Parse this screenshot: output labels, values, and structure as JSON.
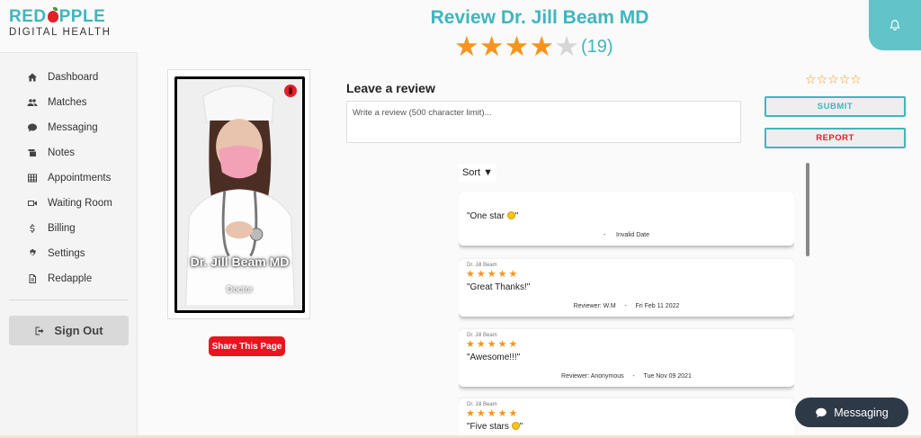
{
  "logo": {
    "line1_a": "RED",
    "line1_b": "PPLE",
    "line2": "DIGITAL HEALTH"
  },
  "header": {
    "title": "Review Dr. Jill Beam MD",
    "rating": 4,
    "max_rating": 5,
    "review_count": "(19)"
  },
  "sidebar": {
    "items": [
      {
        "label": "Dashboard",
        "icon": "home-icon"
      },
      {
        "label": "Matches",
        "icon": "users-icon"
      },
      {
        "label": "Messaging",
        "icon": "chat-icon"
      },
      {
        "label": "Notes",
        "icon": "notes-icon"
      },
      {
        "label": "Appointments",
        "icon": "calendar-grid-icon"
      },
      {
        "label": "Waiting Room",
        "icon": "video-icon"
      },
      {
        "label": "Billing",
        "icon": "dollar-icon"
      },
      {
        "label": "Settings",
        "icon": "gear-icon"
      },
      {
        "label": "Redapple",
        "icon": "document-icon"
      }
    ],
    "signout_label": "Sign Out"
  },
  "profile": {
    "name": "Dr. Jill Beam MD",
    "role": "Doctor",
    "share_label": "Share This Page"
  },
  "review_form": {
    "title": "Leave a review",
    "placeholder": "Write a review (500 character limit)...",
    "submit_label": "SUBMIT",
    "report_label": "REPORT"
  },
  "sort_label": "Sort ▼",
  "reviews": [
    {
      "doctor": "",
      "stars": 0,
      "text": "\"One star ",
      "text_end": "\"",
      "reviewer": "",
      "sep": "-",
      "date": "Invalid Date"
    },
    {
      "doctor": "Dr. Jill Beam",
      "stars": 5,
      "text": "\"Great Thanks!\"",
      "text_end": "",
      "reviewer": "Reviewer: W.M",
      "sep": "-",
      "date": "Fri Feb 11 2022"
    },
    {
      "doctor": "Dr. Jill Beam",
      "stars": 5,
      "text": "\"Awesome!!!\"",
      "text_end": "",
      "reviewer": "Reviewer: Anonymous",
      "sep": "-",
      "date": "Tue Nov 09 2021"
    },
    {
      "doctor": "Dr. Jill Beam",
      "stars": 5,
      "text": "\"Five stars ",
      "text_end": "\"",
      "reviewer": "",
      "sep": "",
      "date": ""
    }
  ],
  "messaging_label": "Messaging",
  "colors": {
    "brand_teal": "#3fb6bd",
    "star_orange": "#f7941d",
    "accent_red": "#e0202a",
    "dark_pill": "#2e3947"
  }
}
